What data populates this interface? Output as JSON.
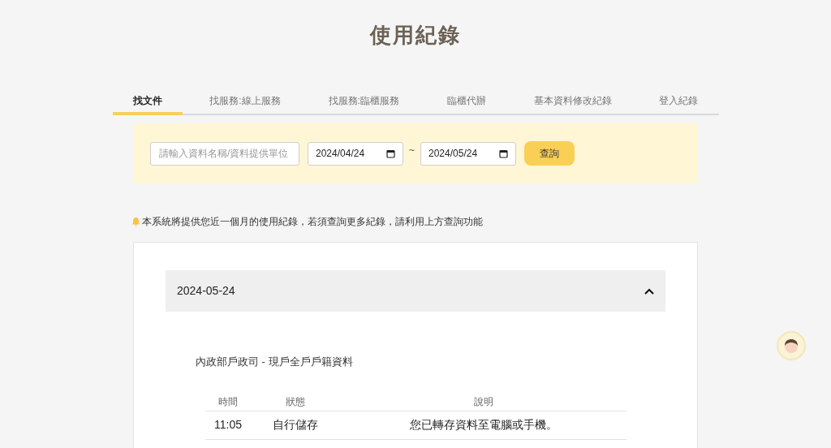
{
  "title": "使用紀錄",
  "tabs": [
    {
      "label": "找文件",
      "selected": true
    },
    {
      "label": "找服務:線上服務",
      "selected": false
    },
    {
      "label": "找服務:臨櫃服務",
      "selected": false
    },
    {
      "label": "臨櫃代辦",
      "selected": false
    },
    {
      "label": "基本資料修改紀錄",
      "selected": false
    },
    {
      "label": "登入紀錄",
      "selected": false
    }
  ],
  "filter": {
    "search": {
      "placeholder": "請輸入資料名稱/資料提供單位"
    },
    "date_from": "2024/04/24",
    "separator": "~",
    "date_to": "2024/05/24",
    "button": "查詢"
  },
  "notice": "本系統將提供您近一個月的使用紀錄，若須查詢更多紀錄，請利用上方查詢功能",
  "records": [
    {
      "date": "2024-05-24",
      "expanded": true,
      "groups": [
        {
          "title": "內政部戶政司 - 現戶全戶戶籍資料",
          "columns": [
            "時間",
            "狀態",
            "說明"
          ],
          "rows": [
            [
              "11:05",
              "自行儲存",
              "您已轉存資料至電腦或手機。"
            ]
          ]
        }
      ]
    }
  ]
}
